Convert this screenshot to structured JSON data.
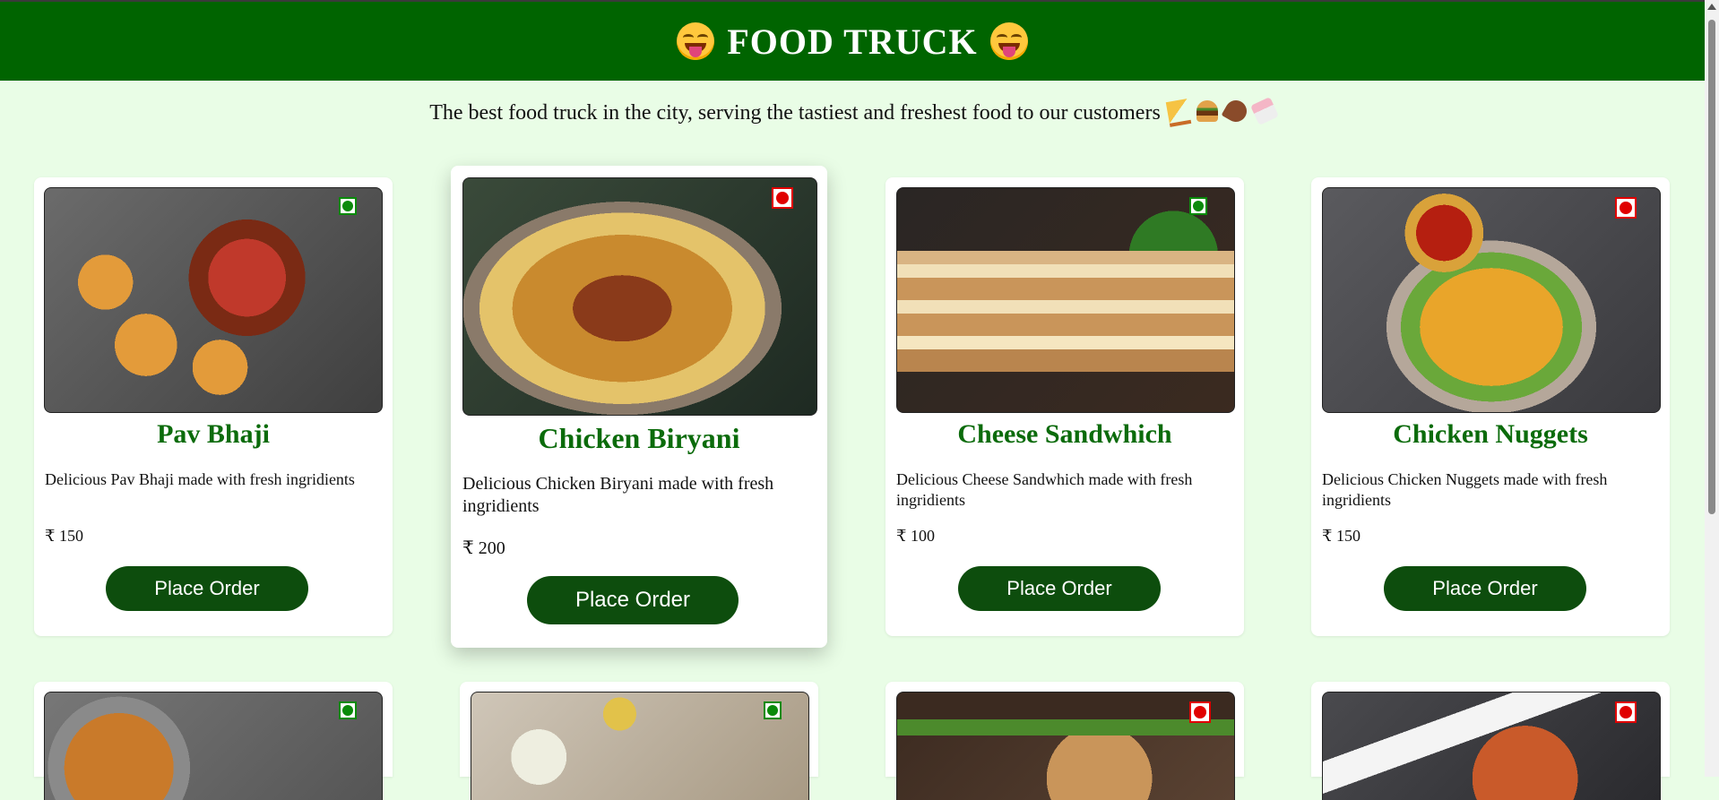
{
  "header": {
    "title": "FOOD TRUCK",
    "icon_left": "yum-face-icon",
    "icon_right": "yum-face-icon"
  },
  "tagline": {
    "text": "The best food truck in the city, serving the tastiest and freshest food to our customers",
    "icons": [
      "pizza-icon",
      "burger-icon",
      "drumstick-icon",
      "drink-icon"
    ]
  },
  "colors": {
    "header_bg": "#006400",
    "page_bg": "#e9fde6",
    "title_green": "#0b6b0b",
    "button_bg": "#0d4d0d",
    "veg": "#0a8a0a",
    "nonveg": "#e00000"
  },
  "button_label": "Place Order",
  "items": [
    {
      "name": "Pav Bhaji",
      "desc": "Delicious Pav Bhaji made with fresh ingridients",
      "price": "₹ 150",
      "type": "veg"
    },
    {
      "name": "Chicken Biryani",
      "desc": "Delicious Chicken Biryani made with fresh ingridients",
      "price": "₹ 200",
      "type": "nonveg"
    },
    {
      "name": "Cheese Sandwhich",
      "desc": "Delicious Cheese Sandwhich made with fresh ingridients",
      "price": "₹ 100",
      "type": "veg"
    },
    {
      "name": "Chicken Nuggets",
      "desc": "Delicious Chicken Nuggets made with fresh ingridients",
      "price": "₹ 150",
      "type": "nonveg"
    },
    {
      "type": "veg"
    },
    {
      "type": "veg"
    },
    {
      "type": "nonveg"
    },
    {
      "type": "nonveg"
    }
  ]
}
